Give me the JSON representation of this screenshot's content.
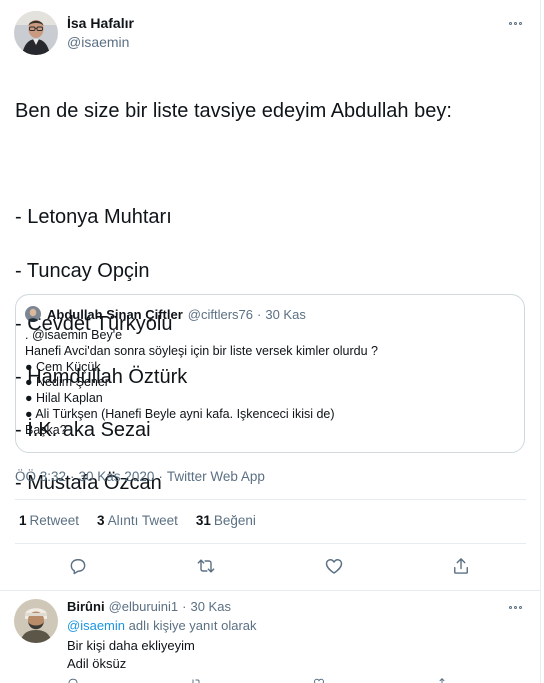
{
  "main_tweet": {
    "author_name": "İsa Hafalır",
    "author_handle": "@isaemin",
    "text_lines": [
      "Ben de size bir liste tavsiye edeyim Abdullah bey:",
      "",
      "- Letonya Muhtarı",
      "- Tuncay Opçin",
      "- Cevdet Türkyolu",
      "- Hamdullah Öztürk",
      "- İ.K. aka Sezai",
      "- Mustafa Özcan"
    ],
    "quote": {
      "author_name": "Abdullah Sinan Çiftler",
      "author_handle": "@ciftlers76",
      "separator": "·",
      "date": "30 Kas",
      "lines": [
        ". @isaemin Bey'e",
        "Hanefi Avci'dan sonra söyleşi için  bir liste versek kimler olurdu ?",
        "● Cem Küçük",
        "● Nedim Şener",
        "● Hilal Kaplan",
        "● Ali Türkşen (Hanefi Beyle ayni kafa. Işkenceci ikisi de)",
        "Başka?"
      ]
    },
    "meta": {
      "time": "ÖÖ 3:32",
      "separator": "·",
      "date": "30 Kas 2020",
      "source": "Twitter Web App"
    },
    "stats": [
      {
        "count": "1",
        "label": "Retweet"
      },
      {
        "count": "3",
        "label": "Alıntı Tweet"
      },
      {
        "count": "31",
        "label": "Beğeni"
      }
    ],
    "actions": [
      "reply-icon",
      "retweet-icon",
      "like-icon",
      "share-icon"
    ]
  },
  "reply_tweet": {
    "author_name": "Birûni",
    "author_handle": "@elburuini1",
    "separator": "·",
    "date": "30 Kas",
    "replying_mention": "@isaemin",
    "replying_suffix": " adlı kişiye yanıt olarak",
    "text_lines": [
      "Bir kişi daha ekliyeyim",
      "Adil öksüz"
    ]
  },
  "colors": {
    "text_primary": "#0f1419",
    "text_secondary": "#5b7083",
    "link": "#1b95e0",
    "border": "#e6ecf0"
  }
}
